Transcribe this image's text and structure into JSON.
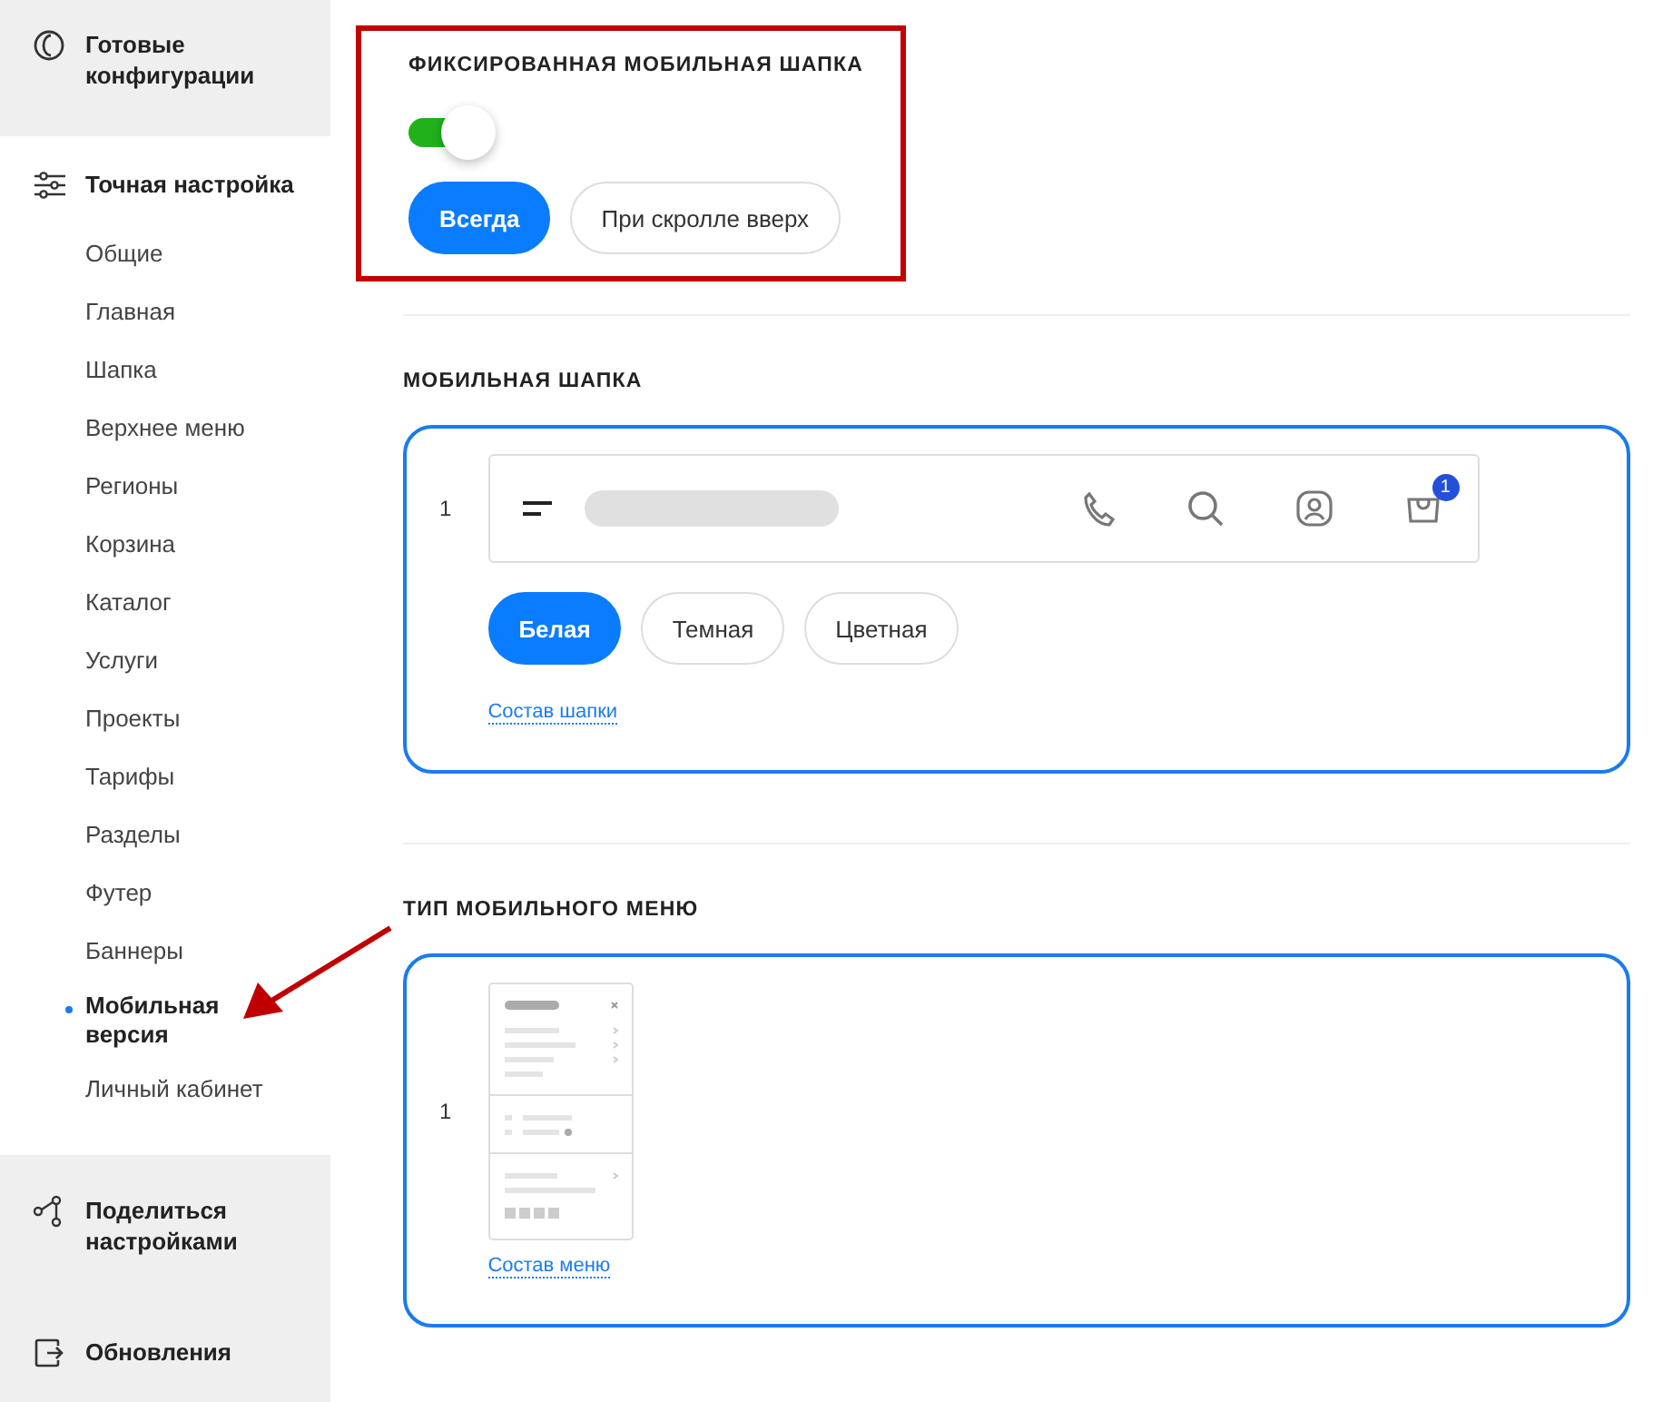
{
  "sidebar": {
    "top": {
      "label": "Готовые конфигурации"
    },
    "section": {
      "title": "Точная настройка",
      "items": [
        {
          "label": "Общие",
          "selected": false
        },
        {
          "label": "Главная",
          "selected": false
        },
        {
          "label": "Шапка",
          "selected": false
        },
        {
          "label": "Верхнее меню",
          "selected": false
        },
        {
          "label": "Регионы",
          "selected": false
        },
        {
          "label": "Корзина",
          "selected": false
        },
        {
          "label": "Каталог",
          "selected": false
        },
        {
          "label": "Услуги",
          "selected": false
        },
        {
          "label": "Проекты",
          "selected": false
        },
        {
          "label": "Тарифы",
          "selected": false
        },
        {
          "label": "Разделы",
          "selected": false
        },
        {
          "label": "Футер",
          "selected": false
        },
        {
          "label": "Баннеры",
          "selected": false
        },
        {
          "label": "Мобильная версия",
          "selected": true
        },
        {
          "label": "Личный кабинет",
          "selected": false
        }
      ]
    },
    "bottom": [
      {
        "label": "Поделиться настройками"
      },
      {
        "label": "Обновления"
      }
    ]
  },
  "fixed_header": {
    "title": "ФИКСИРОВАННАЯ МОБИЛЬНАЯ ШАПКА",
    "highlighted": true,
    "on": true,
    "options": [
      {
        "label": "Всегда",
        "selected": true
      },
      {
        "label": "При скролле вверх",
        "selected": false
      }
    ]
  },
  "mobile_header": {
    "title": "МОБИЛЬНАЯ ШАПКА",
    "number": "1",
    "cart_count": "1",
    "styles": [
      {
        "label": "Белая",
        "selected": true
      },
      {
        "label": "Темная",
        "selected": false
      },
      {
        "label": "Цветная",
        "selected": false
      }
    ],
    "link": "Состав шапки"
  },
  "mobile_menu": {
    "title": "ТИП МОБИЛЬНОГО МЕНЮ",
    "number": "1",
    "link": "Состав меню"
  },
  "pointer_arrow": true
}
